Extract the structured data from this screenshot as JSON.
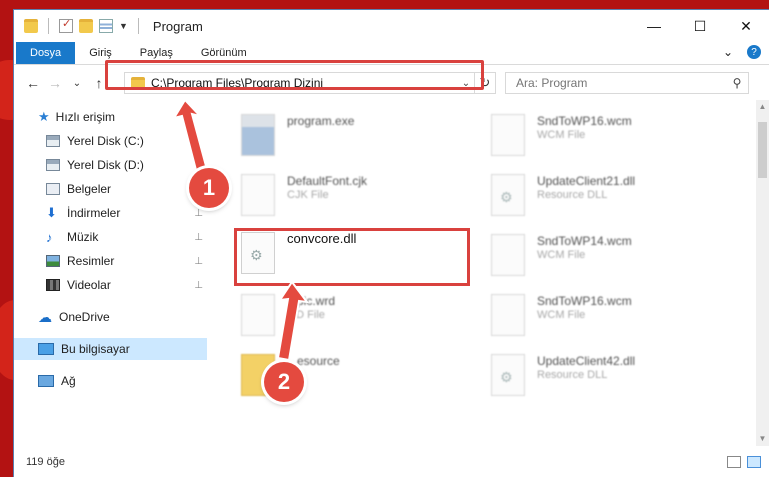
{
  "window": {
    "title": "Program",
    "controls": {
      "minimize": "—",
      "maximize": "☐",
      "close": "✕"
    }
  },
  "ribbon": {
    "tabs": [
      "Dosya",
      "Giriş",
      "Paylaş",
      "Görünüm"
    ],
    "expand_glyph": "⌄",
    "help_glyph": "?"
  },
  "nav": {
    "back": "←",
    "forward": "→",
    "recent": "⌄",
    "up": "↑",
    "address": "C:\\Program Files\\Program Dizini",
    "address_dropdown": "⌄",
    "refresh": "↻",
    "search_placeholder": "Ara: Program",
    "search_icon": "⚲"
  },
  "sidebar": {
    "items": [
      {
        "label": "Hızlı erişim",
        "icon": "star-icon"
      },
      {
        "label": "Yerel Disk (C:)",
        "icon": "drive-icon"
      },
      {
        "label": "Yerel Disk (D:)",
        "icon": "drive-icon"
      },
      {
        "label": "Belgeler",
        "icon": "documents-icon"
      },
      {
        "label": "İndirmeler",
        "icon": "download-icon"
      },
      {
        "label": "Müzik",
        "icon": "music-icon"
      },
      {
        "label": "Resimler",
        "icon": "pictures-icon"
      },
      {
        "label": "Videolar",
        "icon": "videos-icon"
      },
      {
        "label": "OneDrive",
        "icon": "cloud-icon"
      },
      {
        "label": "Bu bilgisayar",
        "icon": "computer-icon"
      },
      {
        "label": "Ağ",
        "icon": "network-icon"
      }
    ],
    "pin_glyph": "📌"
  },
  "files": {
    "left": [
      {
        "name": "program.exe",
        "type": ""
      },
      {
        "name": "DefaultFont.cjk",
        "type": "CJK File"
      },
      {
        "name": "convcore.dll",
        "type": ""
      },
      {
        "name": "...pic.wrd",
        "type": "...D File"
      },
      {
        "name": "...esource",
        "type": ""
      }
    ],
    "right": [
      {
        "name": "SndToWP16.wcm",
        "type": "WCM File"
      },
      {
        "name": "UpdateClient21.dll",
        "type": "Resource DLL"
      },
      {
        "name": "SndToWP14.wcm",
        "type": "WCM File"
      },
      {
        "name": "SndToWP16.wcm",
        "type": "WCM File"
      },
      {
        "name": "UpdateClient42.dll",
        "type": "Resource DLL"
      }
    ]
  },
  "status": {
    "item_count": "119 öğe"
  },
  "annotations": {
    "badge1": "1",
    "badge2": "2",
    "color": "#e44a3f"
  }
}
